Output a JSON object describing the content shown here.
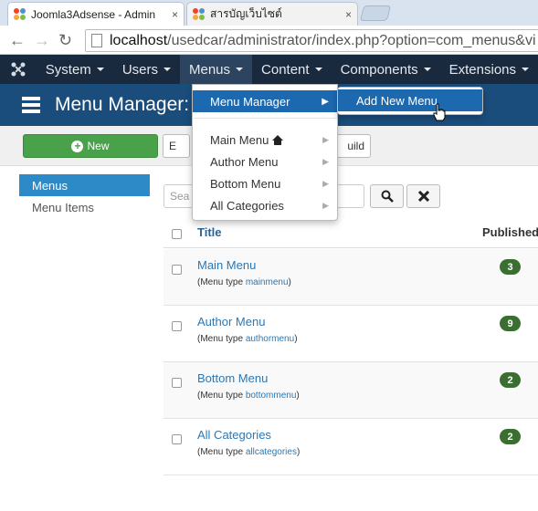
{
  "browser": {
    "tabs": [
      {
        "title": "Joomla3Adsense - Admin",
        "close": "×"
      },
      {
        "title": "สารบัญเว็บไซต์",
        "close": "×"
      }
    ],
    "nav": {
      "back": "←",
      "forward": "→",
      "reload": "↻"
    },
    "url_host": "localhost",
    "url_rest": "/usedcar/administrator/index.php?option=com_menus&vi"
  },
  "topnav": {
    "items": [
      "System",
      "Users",
      "Menus",
      "Content",
      "Components",
      "Extensions"
    ]
  },
  "page_title": "Menu Manager: M",
  "toolbar": {
    "new_label": "New",
    "edit_label": "E",
    "rebuild_label": "uild"
  },
  "sidebar": {
    "items": [
      "Menus",
      "Menu Items"
    ]
  },
  "search": {
    "placeholder": "Sea",
    "search_icon": "🔍",
    "clear_icon": "✕"
  },
  "table": {
    "col_title": "Title",
    "col_published": "Published",
    "rows": [
      {
        "name": "Main Menu",
        "type_prefix": "(Menu type ",
        "type": "mainmenu",
        "type_suffix": ")",
        "count": "3"
      },
      {
        "name": "Author Menu",
        "type_prefix": "(Menu type ",
        "type": "authormenu",
        "type_suffix": ")",
        "count": "9"
      },
      {
        "name": "Bottom Menu",
        "type_prefix": "(Menu type ",
        "type": "bottommenu",
        "type_suffix": ")",
        "count": "2"
      },
      {
        "name": "All Categories",
        "type_prefix": "(Menu type ",
        "type": "allcategories",
        "type_suffix": ")",
        "count": "2"
      }
    ]
  },
  "menus_dropdown": {
    "manager": "Menu Manager",
    "items": [
      "Main Menu",
      "Author Menu",
      "Bottom Menu",
      "All Categories"
    ]
  },
  "submenu": {
    "add_new": "Add New Menu"
  },
  "colors": {
    "topnav_bg": "#192a3f",
    "subhead_bg": "#1b4d7c",
    "accent_blue": "#1c69b0",
    "new_button_green": "#49a24a",
    "badge_green": "#3a6f31"
  }
}
